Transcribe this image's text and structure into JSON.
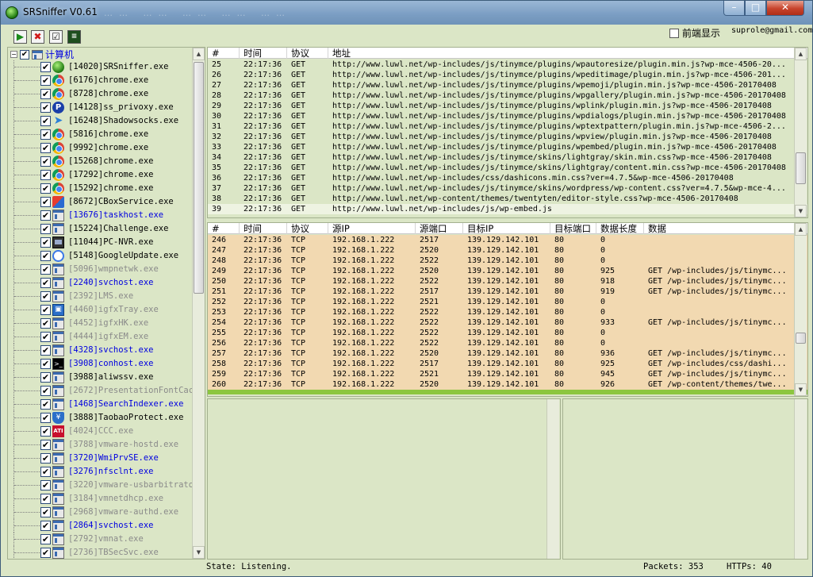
{
  "window": {
    "title": "SRSniffer V0.61",
    "ghost_tabs": "……  …… …… …… ……"
  },
  "window_controls": {
    "minimize": "–",
    "maximize": "□",
    "close": "✕"
  },
  "toolbar": {
    "start_icon": "play-icon",
    "stop_icon": "stop-icon",
    "filter_icon": "checklist-icon",
    "export_icon": "export-icon",
    "start_glyph": "▶",
    "stop_glyph": "✖",
    "filter_glyph": "☑",
    "export_glyph": "≡",
    "front_display_label": "前端显示",
    "email": "suprole@gmail.com"
  },
  "tree": {
    "root_label": "计算机",
    "items": [
      {
        "label": "[14020]SRSniffer.exe",
        "icon": "srs",
        "style": "normal"
      },
      {
        "label": "[6176]chrome.exe",
        "icon": "chrome",
        "style": "normal"
      },
      {
        "label": "[8728]chrome.exe",
        "icon": "chrome",
        "style": "normal"
      },
      {
        "label": "[14128]ss_privoxy.exe",
        "icon": "privoxy",
        "style": "normal"
      },
      {
        "label": "[16248]Shadowsocks.exe",
        "icon": "ss",
        "style": "normal"
      },
      {
        "label": "[5816]chrome.exe",
        "icon": "chrome",
        "style": "normal"
      },
      {
        "label": "[9992]chrome.exe",
        "icon": "chrome",
        "style": "normal"
      },
      {
        "label": "[15268]chrome.exe",
        "icon": "chrome",
        "style": "normal"
      },
      {
        "label": "[17292]chrome.exe",
        "icon": "chrome",
        "style": "normal"
      },
      {
        "label": "[15292]chrome.exe",
        "icon": "chrome",
        "style": "normal"
      },
      {
        "label": "[8672]CBoxService.exe",
        "icon": "cbox",
        "style": "normal"
      },
      {
        "label": "[13676]taskhost.exe",
        "icon": "window",
        "style": "service"
      },
      {
        "label": "[15224]Challenge.exe",
        "icon": "window",
        "style": "normal"
      },
      {
        "label": "[11044]PC-NVR.exe",
        "icon": "nvr",
        "style": "normal"
      },
      {
        "label": "[5148]GoogleUpdate.exe",
        "icon": "gupdate",
        "style": "normal"
      },
      {
        "label": "[5096]wmpnetwk.exe",
        "icon": "window",
        "style": "gray"
      },
      {
        "label": "[2240]svchost.exe",
        "icon": "window",
        "style": "service"
      },
      {
        "label": "[2392]LMS.exe",
        "icon": "window",
        "style": "gray"
      },
      {
        "label": "[4460]igfxTray.exe",
        "icon": "igfx",
        "style": "gray"
      },
      {
        "label": "[4452]igfxHK.exe",
        "icon": "window",
        "style": "gray"
      },
      {
        "label": "[4444]igfxEM.exe",
        "icon": "window",
        "style": "gray"
      },
      {
        "label": "[4328]svchost.exe",
        "icon": "window",
        "style": "service"
      },
      {
        "label": "[3908]conhost.exe",
        "icon": "console",
        "style": "service"
      },
      {
        "label": "[3988]aliwssv.exe",
        "icon": "window",
        "style": "normal"
      },
      {
        "label": "[2672]PresentationFontCach",
        "icon": "window",
        "style": "gray"
      },
      {
        "label": "[1468]SearchIndexer.exe",
        "icon": "window",
        "style": "service"
      },
      {
        "label": "[3888]TaobaoProtect.exe",
        "icon": "taobao",
        "style": "normal"
      },
      {
        "label": "[4024]CCC.exe",
        "icon": "ati",
        "style": "gray"
      },
      {
        "label": "[3788]vmware-hostd.exe",
        "icon": "window",
        "style": "gray"
      },
      {
        "label": "[3720]WmiPrvSE.exe",
        "icon": "window",
        "style": "service"
      },
      {
        "label": "[3276]nfsclnt.exe",
        "icon": "window",
        "style": "service"
      },
      {
        "label": "[3220]vmware-usbarbitrator",
        "icon": "window",
        "style": "gray"
      },
      {
        "label": "[3184]vmnetdhcp.exe",
        "icon": "window",
        "style": "gray"
      },
      {
        "label": "[2968]vmware-authd.exe",
        "icon": "window",
        "style": "gray"
      },
      {
        "label": "[2864]svchost.exe",
        "icon": "window",
        "style": "service"
      },
      {
        "label": "[2792]vmnat.exe",
        "icon": "window",
        "style": "gray"
      },
      {
        "label": "[2736]TBSecSvc.exe",
        "icon": "window",
        "style": "gray"
      }
    ]
  },
  "http_table": {
    "columns": [
      "#",
      "时间",
      "协议",
      "地址"
    ],
    "rows": [
      [
        "25",
        "22:17:36",
        "GET",
        "http://www.luwl.net/wp-includes/js/tinymce/plugins/wpautoresize/plugin.min.js?wp-mce-4506-20..."
      ],
      [
        "26",
        "22:17:36",
        "GET",
        "http://www.luwl.net/wp-includes/js/tinymce/plugins/wpeditimage/plugin.min.js?wp-mce-4506-201..."
      ],
      [
        "27",
        "22:17:36",
        "GET",
        "http://www.luwl.net/wp-includes/js/tinymce/plugins/wpemoji/plugin.min.js?wp-mce-4506-20170408"
      ],
      [
        "28",
        "22:17:36",
        "GET",
        "http://www.luwl.net/wp-includes/js/tinymce/plugins/wpgallery/plugin.min.js?wp-mce-4506-20170408"
      ],
      [
        "29",
        "22:17:36",
        "GET",
        "http://www.luwl.net/wp-includes/js/tinymce/plugins/wplink/plugin.min.js?wp-mce-4506-20170408"
      ],
      [
        "30",
        "22:17:36",
        "GET",
        "http://www.luwl.net/wp-includes/js/tinymce/plugins/wpdialogs/plugin.min.js?wp-mce-4506-20170408"
      ],
      [
        "31",
        "22:17:36",
        "GET",
        "http://www.luwl.net/wp-includes/js/tinymce/plugins/wptextpattern/plugin.min.js?wp-mce-4506-2..."
      ],
      [
        "32",
        "22:17:36",
        "GET",
        "http://www.luwl.net/wp-includes/js/tinymce/plugins/wpview/plugin.min.js?wp-mce-4506-20170408"
      ],
      [
        "33",
        "22:17:36",
        "GET",
        "http://www.luwl.net/wp-includes/js/tinymce/plugins/wpembed/plugin.min.js?wp-mce-4506-20170408"
      ],
      [
        "34",
        "22:17:36",
        "GET",
        "http://www.luwl.net/wp-includes/js/tinymce/skins/lightgray/skin.min.css?wp-mce-4506-20170408"
      ],
      [
        "35",
        "22:17:36",
        "GET",
        "http://www.luwl.net/wp-includes/js/tinymce/skins/lightgray/content.min.css?wp-mce-4506-20170408"
      ],
      [
        "36",
        "22:17:36",
        "GET",
        "http://www.luwl.net/wp-includes/css/dashicons.min.css?ver=4.7.5&wp-mce-4506-20170408"
      ],
      [
        "37",
        "22:17:36",
        "GET",
        "http://www.luwl.net/wp-includes/js/tinymce/skins/wordpress/wp-content.css?ver=4.7.5&wp-mce-4..."
      ],
      [
        "38",
        "22:17:36",
        "GET",
        "http://www.luwl.net/wp-content/themes/twentyten/editor-style.css?wp-mce-4506-20170408"
      ],
      [
        "39",
        "22:17:36",
        "GET",
        "http://www.luwl.net/wp-includes/js/wp-embed.js"
      ]
    ]
  },
  "tcp_table": {
    "columns": [
      "#",
      "时间",
      "协议",
      "源IP",
      "源端口",
      "目标IP",
      "目标端口",
      "数据长度",
      "数据"
    ],
    "rows": [
      [
        "246",
        "22:17:36",
        "TCP",
        "192.168.1.222",
        "2517",
        "139.129.142.101",
        "80",
        "0",
        ""
      ],
      [
        "247",
        "22:17:36",
        "TCP",
        "192.168.1.222",
        "2520",
        "139.129.142.101",
        "80",
        "0",
        ""
      ],
      [
        "248",
        "22:17:36",
        "TCP",
        "192.168.1.222",
        "2522",
        "139.129.142.101",
        "80",
        "0",
        ""
      ],
      [
        "249",
        "22:17:36",
        "TCP",
        "192.168.1.222",
        "2520",
        "139.129.142.101",
        "80",
        "925",
        "GET /wp-includes/js/tinymc..."
      ],
      [
        "250",
        "22:17:36",
        "TCP",
        "192.168.1.222",
        "2522",
        "139.129.142.101",
        "80",
        "918",
        "GET /wp-includes/js/tinymc..."
      ],
      [
        "251",
        "22:17:36",
        "TCP",
        "192.168.1.222",
        "2517",
        "139.129.142.101",
        "80",
        "919",
        "GET /wp-includes/js/tinymc..."
      ],
      [
        "252",
        "22:17:36",
        "TCP",
        "192.168.1.222",
        "2521",
        "139.129.142.101",
        "80",
        "0",
        ""
      ],
      [
        "253",
        "22:17:36",
        "TCP",
        "192.168.1.222",
        "2522",
        "139.129.142.101",
        "80",
        "0",
        ""
      ],
      [
        "254",
        "22:17:36",
        "TCP",
        "192.168.1.222",
        "2522",
        "139.129.142.101",
        "80",
        "933",
        "GET /wp-includes/js/tinymc..."
      ],
      [
        "255",
        "22:17:36",
        "TCP",
        "192.168.1.222",
        "2522",
        "139.129.142.101",
        "80",
        "0",
        ""
      ],
      [
        "256",
        "22:17:36",
        "TCP",
        "192.168.1.222",
        "2522",
        "139.129.142.101",
        "80",
        "0",
        ""
      ],
      [
        "257",
        "22:17:36",
        "TCP",
        "192.168.1.222",
        "2520",
        "139.129.142.101",
        "80",
        "936",
        "GET /wp-includes/js/tinymc..."
      ],
      [
        "258",
        "22:17:36",
        "TCP",
        "192.168.1.222",
        "2517",
        "139.129.142.101",
        "80",
        "925",
        "GET /wp-includes/css/dashi..."
      ],
      [
        "259",
        "22:17:36",
        "TCP",
        "192.168.1.222",
        "2521",
        "139.129.142.101",
        "80",
        "945",
        "GET /wp-includes/js/tinymc..."
      ],
      [
        "260",
        "22:17:36",
        "TCP",
        "192.168.1.222",
        "2520",
        "139.129.142.101",
        "80",
        "926",
        "GET /wp-content/themes/twe..."
      ]
    ]
  },
  "status": {
    "state": "State: Listening.",
    "packets": "Packets: 353",
    "https": "HTTPs: 40"
  }
}
